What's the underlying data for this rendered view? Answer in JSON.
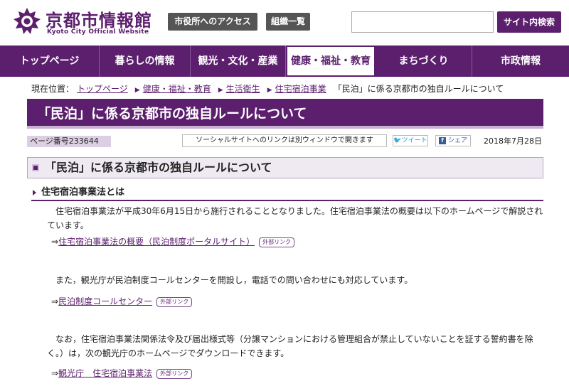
{
  "header": {
    "site_title": "京都市情報館",
    "site_subtitle": "Kyoto City Official Website",
    "access_button": "市役所へのアクセス",
    "org_button": "組織一覧",
    "search_placeholder": "",
    "search_button": "サイト内検索"
  },
  "nav": {
    "items": [
      {
        "label": "トップページ"
      },
      {
        "label": "暮らしの情報"
      },
      {
        "label": "観光・文化・産業"
      },
      {
        "label": "健康・福祉・教育"
      },
      {
        "label": "まちづくり"
      },
      {
        "label": "市政情報"
      }
    ],
    "active_index": 3
  },
  "breadcrumb": {
    "prefix": "現在位置：",
    "links": [
      "トップページ",
      "健康・福祉・教育",
      "生活衛生",
      "住宅宿泊事業"
    ],
    "current": "「民泊」に係る京都市の独自ルールについて"
  },
  "page": {
    "title": "「民泊」に係る京都市の独自ルールについて",
    "page_number": "ページ番号233644",
    "social_note": "ソーシャルサイトへのリンクは別ウィンドウで開きます",
    "tweet_label": "ツイート",
    "share_label": "シェア",
    "date": "2018年7月28日"
  },
  "content": {
    "section_heading": "「民泊」に係る京都市の独自ルールについて",
    "subheading": "住宅宿泊事業法とは",
    "para1": "住宅宿泊事業法が平成30年6月15日から施行されることとなりました。住宅宿泊事業法の概要は以下のホームページで解説されています。",
    "link1_prefix": "⇒",
    "link1": "住宅宿泊事業法の概要（民泊制度ポータルサイト）",
    "para2": "また，観光庁が民泊制度コールセンターを開設し，電話での問い合わせにも対応しています。",
    "link2_prefix": "⇒",
    "link2": "民泊制度コールセンター",
    "para3": "なお，住宅宿泊事業法関係法令及び届出様式等（分譲マンションにおける管理組合が禁止していないことを証する誓約書を除く。）は，次の観光庁のホームページでダウンロードできます。",
    "link3_prefix": "⇒",
    "link3": "観光庁　住宅宿泊事業法",
    "external_badge": "外部リンク"
  },
  "colors": {
    "brand_purple": "#5c1f6e",
    "light_purple": "#dccfe3",
    "button_gray": "#555555"
  }
}
